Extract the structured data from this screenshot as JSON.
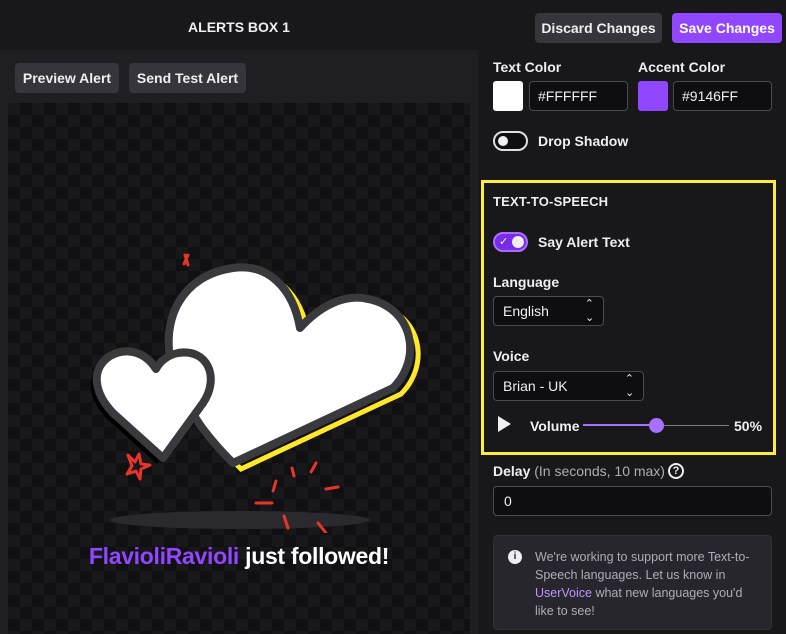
{
  "header": {
    "title": "ALERTS BOX 1",
    "discard_label": "Discard Changes",
    "save_label": "Save Changes"
  },
  "preview_toolbar": {
    "preview_label": "Preview Alert",
    "send_test_label": "Send Test Alert"
  },
  "preview": {
    "username": "FlavioliRavioli",
    "message": " just followed!",
    "image": "hearts-graphic"
  },
  "colors": {
    "text_color_label": "Text Color",
    "text_color_value": "#FFFFFF",
    "accent_color_label": "Accent Color",
    "accent_color_value": "#9146FF"
  },
  "drop_shadow": {
    "label": "Drop Shadow",
    "enabled": false
  },
  "tts": {
    "section_title": "TEXT-TO-SPEECH",
    "say_alert_label": "Say Alert Text",
    "say_alert_enabled": true,
    "language_label": "Language",
    "language_value": "English",
    "voice_label": "Voice",
    "voice_value": "Brian - UK",
    "volume_label": "Volume",
    "volume_value": "50%",
    "volume_fraction": 0.5
  },
  "delay": {
    "label": "Delay",
    "hint": "(In seconds, 10 max)",
    "value": "0"
  },
  "info": {
    "text_before": "We're working to support more Text-to-Speech languages. Let us know in ",
    "link": "UserVoice",
    "text_after": " what new languages you'd like to see!"
  },
  "icons": {
    "help": "question-circle-icon",
    "info": "info-circle-icon",
    "play": "play-icon",
    "select": "chevron-up-down-icon"
  },
  "accent": "#9146ff",
  "highlight": "#ffeb3b"
}
